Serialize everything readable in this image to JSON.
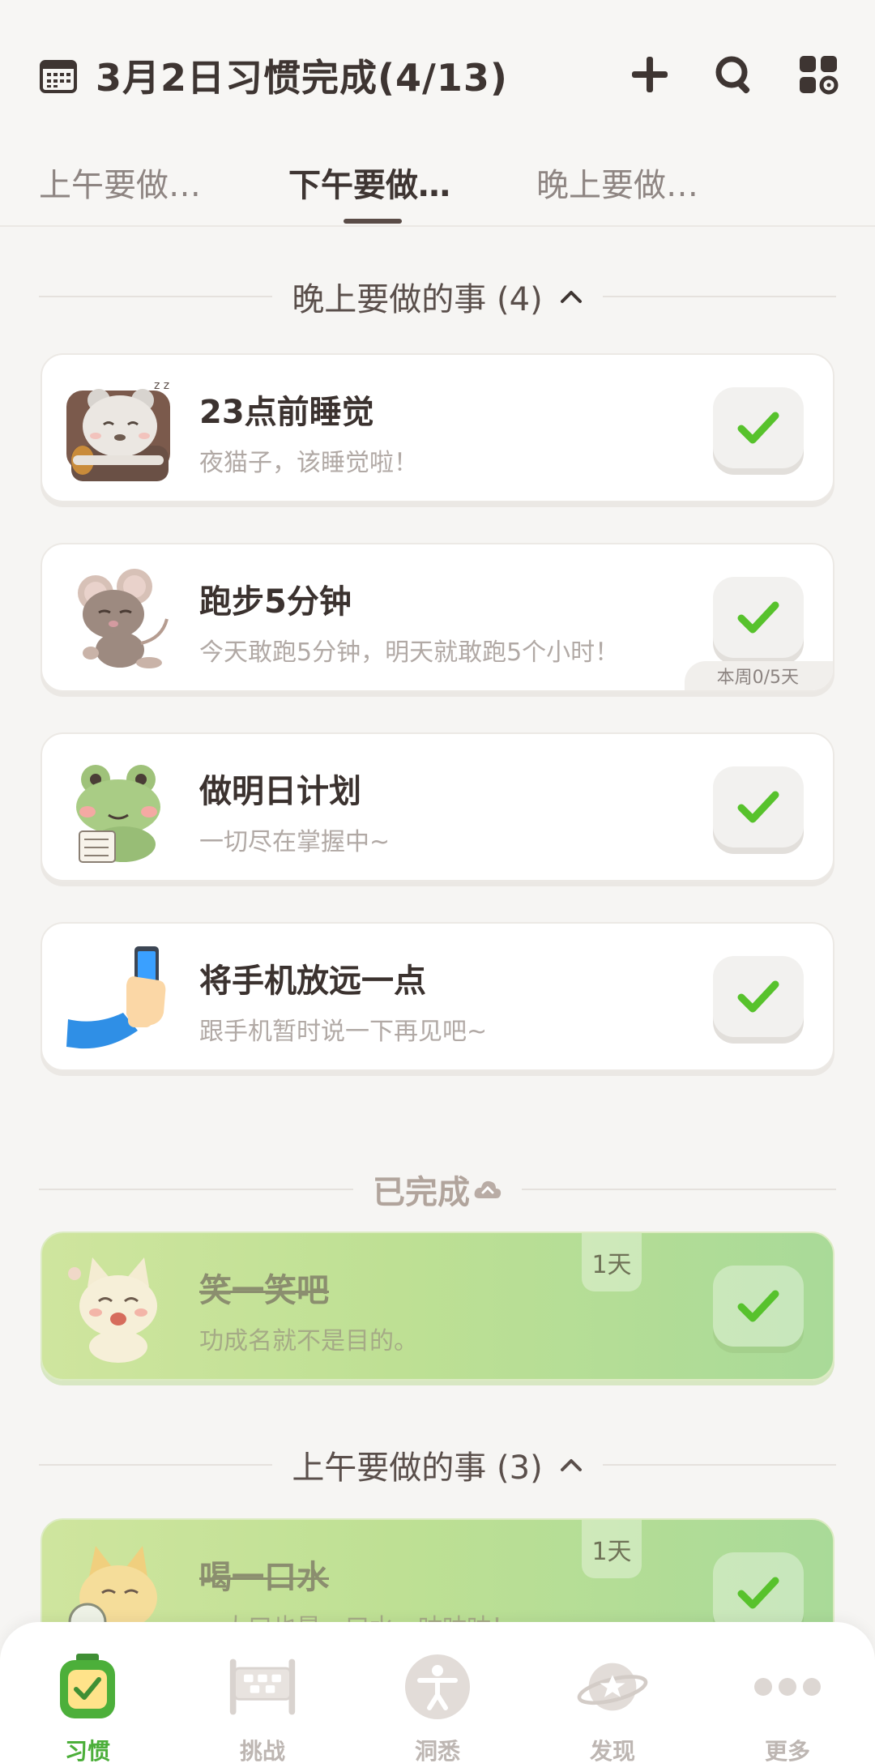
{
  "header": {
    "title": "3月2日习惯完成(4/13)",
    "actions": [
      "plus-icon",
      "search-icon",
      "grid-settings-icon"
    ]
  },
  "tabs": [
    {
      "label": "上午要做…",
      "active": false
    },
    {
      "label": "下午要做…",
      "active": true
    },
    {
      "label": "晚上要做…",
      "active": false
    }
  ],
  "sections": {
    "evening": {
      "label": "晚上要做的事 (4)"
    },
    "completed": {
      "label": "已完成"
    },
    "morning": {
      "label": "上午要做的事 (3)"
    }
  },
  "habits": [
    {
      "name": "23点前睡觉",
      "desc": "夜猫子，该睡觉啦！",
      "icon": "sleeping-bear-icon"
    },
    {
      "name": "跑步5分钟",
      "desc": "今天敢跑5分钟，明天就敢跑5个小时！",
      "icon": "running-mouse-icon",
      "week": "本周0/5天"
    },
    {
      "name": "做明日计划",
      "desc": "一切尽在掌握中~",
      "icon": "frog-planning-icon"
    },
    {
      "name": "将手机放远一点",
      "desc": "跟手机暂时说一下再见吧~",
      "icon": "hand-phone-icon"
    }
  ],
  "completed_habits": [
    {
      "name": "笑一笑吧",
      "desc": "功成名就不是目的。",
      "days": "1天",
      "icon": "laughing-cat-icon"
    },
    {
      "name": "喝一口水",
      "desc": "一大口也是一口水，咕咕咕！",
      "days": "1天",
      "icon": "dog-drinking-icon"
    }
  ],
  "nav": [
    {
      "label": "习惯",
      "icon": "habit-check-icon",
      "active": true
    },
    {
      "label": "挑战",
      "icon": "challenge-board-icon",
      "active": false
    },
    {
      "label": "洞悉",
      "icon": "person-insight-icon",
      "active": false
    },
    {
      "label": "发现",
      "icon": "planet-discover-icon",
      "active": false
    },
    {
      "label": "更多",
      "icon": "more-dots-icon",
      "active": false
    }
  ],
  "colors": {
    "accent_green": "#4caf3a",
    "check_green": "#57c22c",
    "background": "#f6f5f3",
    "completed_gradient_start": "#cfe59e",
    "completed_gradient_end": "#a9da98"
  }
}
